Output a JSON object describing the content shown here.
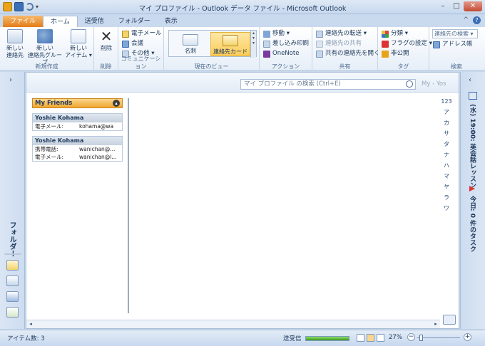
{
  "window": {
    "title": "マイ プロファイル - Outlook データ ファイル - Microsoft Outlook"
  },
  "tabs": [
    {
      "label": "ファイル"
    },
    {
      "label": "ホーム"
    },
    {
      "label": "送受信"
    },
    {
      "label": "フォルダー"
    },
    {
      "label": "表示"
    }
  ],
  "ribbon": {
    "new_group": {
      "label": "新規作成",
      "new_contact": "新しい\n連絡先",
      "new_contact_group": "新しい\n連絡先グループ",
      "new_items": "新しい\nアイテム ▾"
    },
    "delete_group": {
      "label": "削除",
      "delete": "削除"
    },
    "comm_group": {
      "label": "コミュニケーション",
      "email": "電子メール",
      "meeting": "会議",
      "more": "その他 ▾"
    },
    "view_group": {
      "label": "現在のビュー",
      "business_card": "名刺",
      "card": "連絡先カード"
    },
    "action_group": {
      "label": "アクション",
      "move": "移動 ▾",
      "mail_merge": "差し込み印刷",
      "onenote": "OneNote"
    },
    "share_group": {
      "label": "共有",
      "forward": "連絡先の転送 ▾",
      "share": "連絡先の共有",
      "open_shared": "共有の連絡先を開く"
    },
    "tags_group": {
      "label": "タグ",
      "categorize": "分類 ▾",
      "follow_up": "フラグの設定 ▾",
      "private": "非公開"
    },
    "find_group": {
      "label": "検索",
      "search_contacts": "連絡先の検索 ▾",
      "address_book": "アドレス帳"
    }
  },
  "search": {
    "placeholder": "マイ プロファイル の検索 (Ctrl+E)",
    "tag": "My - Yos"
  },
  "contacts": {
    "group_name": "My Friends",
    "cards": [
      {
        "name": "Yoshie Kohama",
        "rows": [
          {
            "label": "電子メール:",
            "value": "kohama@wa"
          }
        ]
      },
      {
        "name": "Yoshie Kohama",
        "rows": [
          {
            "label": "携帯電話:",
            "value": "wanichan@..."
          },
          {
            "label": "電子メール:",
            "value": "wanichan@l..."
          }
        ]
      }
    ]
  },
  "alphabet": [
    "123",
    "ア",
    "カ",
    "サ",
    "タ",
    "ナ",
    "ハ",
    "マ",
    "ヤ",
    "ラ",
    "ワ"
  ],
  "leftnav": {
    "folder_label": "フォルダー"
  },
  "todo": {
    "appointment": "(水) 19:00: 英会話レッスン",
    "tasks": "今日: 0 件のタスク"
  },
  "status": {
    "items": "アイテム数: 3",
    "send_receive": "送受信",
    "zoom": "27%",
    "send_progress_pct": 100
  },
  "colors": {
    "accent": "#e47d1b",
    "selected": "#fbcc58",
    "ribbon_text": "#1e395b"
  }
}
